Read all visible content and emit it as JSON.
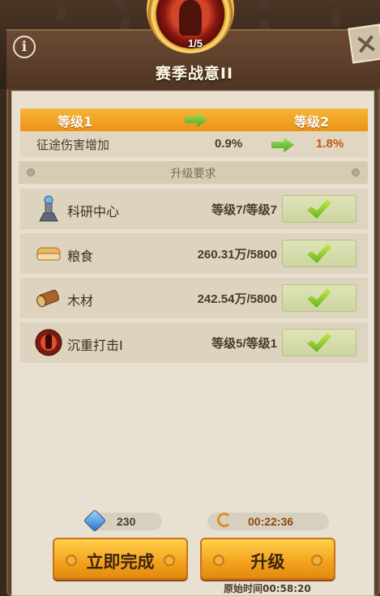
{
  "header": {
    "title": "赛季战意II",
    "level_progress": "1/5",
    "info_icon": "info-icon",
    "close_icon": "close-icon"
  },
  "levels": {
    "current_label": "等级1",
    "next_label": "等级2",
    "stat_name": "征途伤害增加",
    "stat_current": "0.9%",
    "stat_next": "1.8%"
  },
  "requirements": {
    "title": "升级要求",
    "items": [
      {
        "name": "科研中心",
        "value": "等级7/等级7",
        "icon": "research-tower-icon",
        "met": true
      },
      {
        "name": "粮食",
        "value": "260.31万/5800",
        "icon": "bread-icon",
        "met": true
      },
      {
        "name": "木材",
        "value": "242.54万/5800",
        "icon": "wood-log-icon",
        "met": true
      },
      {
        "name": "沉重打击I",
        "value": "等级5/等级1",
        "icon": "heavy-strike-icon",
        "met": true
      }
    ]
  },
  "footer": {
    "gems": "230",
    "timer": "00:22:36",
    "instant_label": "立即完成",
    "upgrade_label": "升级",
    "original_time": "原始时间00:58:20"
  },
  "colors": {
    "accent_orange": "#ec9214",
    "next_value": "#c25a12",
    "check_green": "#64b31f"
  }
}
